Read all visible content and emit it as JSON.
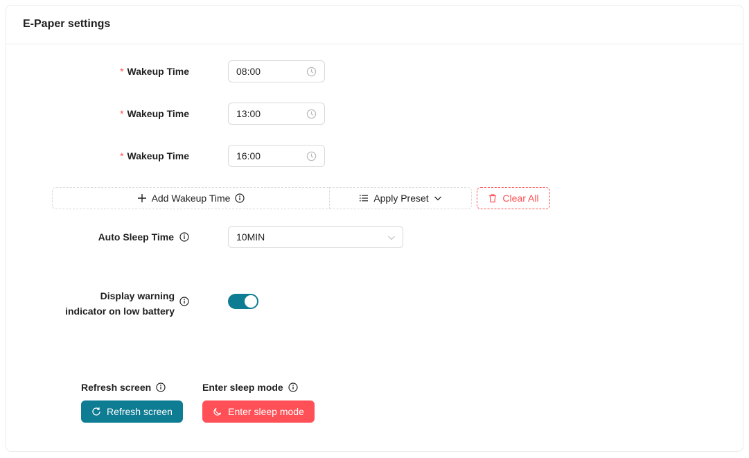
{
  "card": {
    "title": "E-Paper settings"
  },
  "wakeup": {
    "required_mark": "*",
    "items": [
      {
        "label": "Wakeup Time",
        "value": "08:00"
      },
      {
        "label": "Wakeup Time",
        "value": "13:00"
      },
      {
        "label": "Wakeup Time",
        "value": "16:00"
      }
    ]
  },
  "actions_row": {
    "add_label": "Add Wakeup Time",
    "preset_label": "Apply Preset",
    "clear_label": "Clear All"
  },
  "auto_sleep": {
    "label": "Auto Sleep Time",
    "value": "10MIN"
  },
  "battery_warning": {
    "label_line1": "Display warning",
    "label_line2": "indicator on low battery",
    "enabled": true
  },
  "refresh": {
    "label": "Refresh screen",
    "button_label": "Refresh screen"
  },
  "sleep": {
    "label": "Enter sleep mode",
    "button_label": "Enter sleep mode"
  },
  "colors": {
    "primary": "#0e7c93",
    "danger": "#ff5057",
    "required": "#ff4d4f"
  },
  "icons": [
    "clock-icon",
    "plus-icon",
    "info-icon",
    "list-icon",
    "chevron-down-icon",
    "trash-icon",
    "refresh-icon",
    "moon-icon"
  ]
}
